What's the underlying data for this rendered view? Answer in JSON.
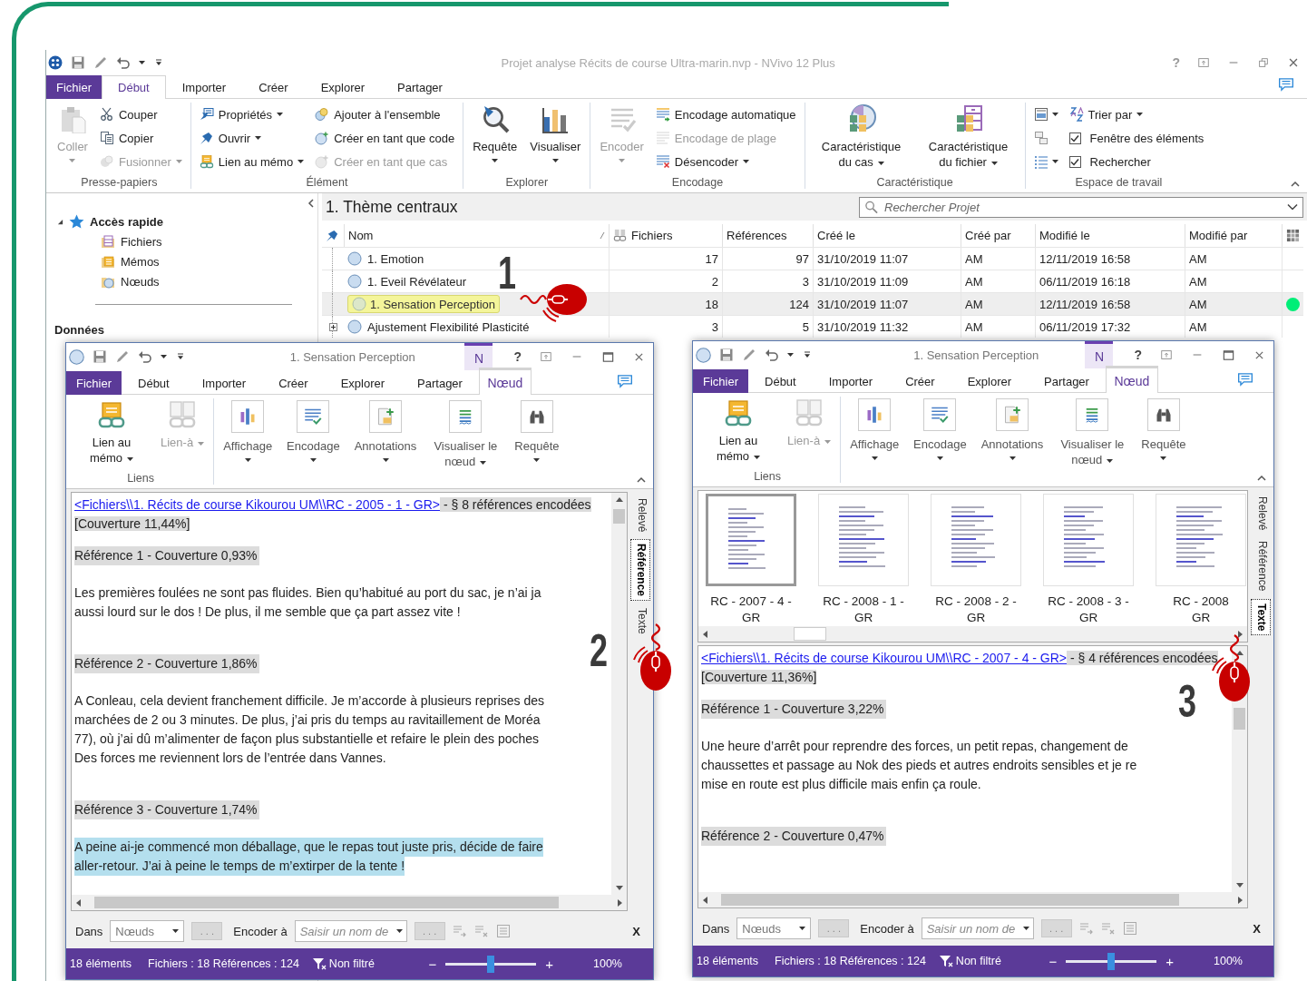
{
  "main_window": {
    "title": "Projet analyse Récits de course Ultra-marin.nvp - NVivo 12 Plus",
    "help": "?",
    "tabs": [
      {
        "label": "Fichier",
        "kind": "file",
        "selected": false
      },
      {
        "label": "Début",
        "kind": "tab",
        "selected": true
      },
      {
        "label": "Importer",
        "kind": "tab",
        "selected": false
      },
      {
        "label": "Créer",
        "kind": "tab",
        "selected": false
      },
      {
        "label": "Explorer",
        "kind": "tab",
        "selected": false
      },
      {
        "label": "Partager",
        "kind": "tab",
        "selected": false
      }
    ],
    "ribbon": [
      {
        "label": "Presse-papiers",
        "columns": [
          [
            {
              "label": "Coller",
              "kind": "large",
              "disabled": true,
              "dropdown": true
            }
          ],
          [
            {
              "label": "Couper",
              "kind": "small",
              "disabled": false,
              "dropdown": false
            },
            {
              "label": "Copier",
              "kind": "small",
              "disabled": false,
              "dropdown": false
            },
            {
              "label": "Fusionner",
              "kind": "small",
              "disabled": true,
              "dropdown": true
            }
          ]
        ]
      },
      {
        "label": "Élément",
        "columns": [
          [
            {
              "label": "Propriétés",
              "kind": "small",
              "disabled": false,
              "dropdown": true
            },
            {
              "label": "Ouvrir",
              "kind": "small",
              "disabled": false,
              "dropdown": true
            },
            {
              "label": "Lien au mémo",
              "kind": "small",
              "disabled": false,
              "dropdown": true
            }
          ],
          [
            {
              "label": "Ajouter à l'ensemble",
              "kind": "small",
              "disabled": false,
              "dropdown": false
            },
            {
              "label": "Créer en tant que code",
              "kind": "small",
              "disabled": false,
              "dropdown": false
            },
            {
              "label": "Créer en tant que cas",
              "kind": "small",
              "disabled": true,
              "dropdown": false
            }
          ]
        ]
      },
      {
        "label": "Explorer",
        "columns": [
          [
            {
              "label": "Requête",
              "kind": "large",
              "disabled": false,
              "dropdown": true
            }
          ],
          [
            {
              "label": "Visualiser",
              "kind": "large",
              "disabled": false,
              "dropdown": true
            }
          ]
        ]
      },
      {
        "label": "Encodage",
        "columns": [
          [
            {
              "label": "Encoder",
              "kind": "large",
              "disabled": true,
              "dropdown": true
            }
          ],
          [
            {
              "label": "Encodage automatique",
              "kind": "small",
              "disabled": false,
              "dropdown": false
            },
            {
              "label": "Encodage de plage",
              "kind": "small",
              "disabled": true,
              "dropdown": false
            },
            {
              "label": "Désencoder",
              "kind": "small",
              "disabled": false,
              "dropdown": true
            }
          ]
        ]
      },
      {
        "label": "Caractéristique",
        "columns": [
          [
            {
              "label": "Caractéristique du cas",
              "kind": "large",
              "disabled": false,
              "dropdown": true
            }
          ],
          [
            {
              "label": "Caractéristique du fichier",
              "kind": "large",
              "disabled": false,
              "dropdown": true
            }
          ]
        ]
      },
      {
        "label": "Espace de travail",
        "columns": [
          [
            {
              "kind": "icon",
              "disabled": false,
              "dropdown": true
            },
            {
              "kind": "icon",
              "disabled": false,
              "dropdown": false
            },
            {
              "kind": "icon",
              "disabled": false,
              "dropdown": true
            }
          ],
          [
            {
              "label": "Trier par",
              "kind": "small",
              "disabled": false,
              "dropdown": true
            },
            {
              "label": "Fenêtre des éléments",
              "kind": "check",
              "checked": true
            },
            {
              "label": "Rechercher",
              "kind": "check",
              "checked": true
            }
          ]
        ]
      }
    ],
    "navigation": {
      "quick_access": {
        "label": "Accès rapide",
        "expanded": true,
        "children": [
          {
            "label": "Fichiers"
          },
          {
            "label": "Mémos"
          },
          {
            "label": "Nœuds"
          }
        ]
      },
      "sections": [
        {
          "label": "Données"
        }
      ]
    },
    "content": {
      "title": "1. Thème centraux",
      "search": {
        "placeholder": "Rechercher Projet"
      },
      "columns": [
        {
          "label": "Nom"
        },
        {
          "label": "Fichiers"
        },
        {
          "label": "Références"
        },
        {
          "label": "Créé le"
        },
        {
          "label": "Créé par"
        },
        {
          "label": "Modifié le"
        },
        {
          "label": "Modifié par"
        }
      ],
      "rows": [
        {
          "name": "1. Emotion",
          "files": "17",
          "references": "97",
          "created": "31/10/2019 11:07",
          "created_by": "AM",
          "modified": "12/11/2019 16:58",
          "modified_by": "AM",
          "selected": false
        },
        {
          "name": "1. Eveil Révélateur",
          "files": "2",
          "references": "3",
          "created": "31/10/2019 11:09",
          "created_by": "AM",
          "modified": "06/11/2019 16:18",
          "modified_by": "AM",
          "selected": false
        },
        {
          "name": "1. Sensation Perception",
          "files": "18",
          "references": "124",
          "created": "31/10/2019 11:07",
          "created_by": "AM",
          "modified": "12/11/2019 16:58",
          "modified_by": "AM",
          "selected": true,
          "color": "#00ee77"
        },
        {
          "name": "Ajustement Flexibilité Plasticité",
          "files": "3",
          "references": "5",
          "created": "31/10/2019 11:32",
          "created_by": "AM",
          "modified": "06/11/2019 17:32",
          "modified_by": "AM",
          "selected": false,
          "expanded": false
        }
      ]
    }
  },
  "child_windows": [
    {
      "title": "1. Sensation Perception",
      "context_label": "N",
      "help": "?",
      "tabs": [
        {
          "label": "Fichier",
          "kind": "file",
          "selected": false
        },
        {
          "label": "Début",
          "kind": "tab",
          "selected": false
        },
        {
          "label": "Importer",
          "kind": "tab",
          "selected": false
        },
        {
          "label": "Créer",
          "kind": "tab",
          "selected": false
        },
        {
          "label": "Explorer",
          "kind": "tab",
          "selected": false
        },
        {
          "label": "Partager",
          "kind": "tab",
          "selected": false
        },
        {
          "label": "Nœud",
          "kind": "context",
          "selected": true
        }
      ],
      "ribbon": [
        {
          "label": "Liens",
          "columns": [
            [
              {
                "label": "Lien au mémo",
                "kind": "large",
                "disabled": false,
                "dropdown": true
              }
            ],
            [
              {
                "label": "Lien-à",
                "kind": "large",
                "disabled": true,
                "dropdown": true
              }
            ]
          ]
        },
        {
          "columns": [
            [
              {
                "label": "Affichage",
                "kind": "framed",
                "disabled": false,
                "dropdown": true
              }
            ],
            [
              {
                "label": "Encodage",
                "kind": "framed",
                "disabled": false,
                "dropdown": true
              }
            ],
            [
              {
                "label": "Annotations",
                "kind": "framed",
                "disabled": false,
                "dropdown": true
              }
            ],
            [
              {
                "label": "Visualiser le nœud",
                "kind": "framed",
                "disabled": false,
                "dropdown": true
              }
            ],
            [
              {
                "label": "Requête",
                "kind": "framed",
                "disabled": false,
                "dropdown": true
              }
            ]
          ]
        }
      ],
      "document": {
        "link": "<Fichiers\\\\1. Récits de course Kikourou UM\\\\RC - 2005 - 1 - GR>",
        "summary": "- § 8 références encodées",
        "coverage": "[Couverture 11,44%]",
        "blocks": [
          {
            "kind": "reference",
            "text": "Référence 1 - Couverture 0,93%"
          },
          {
            "kind": "passage",
            "highlighted": false,
            "lines": [
              "Les premières foulées ne sont pas fluides. Bien qu’habitué au port du sac, je n’ai ja",
              "aussi lourd sur le dos ! De plus, il me semble que ça part assez vite !"
            ]
          },
          {
            "kind": "reference",
            "text": "Référence 2 - Couverture 1,86%"
          },
          {
            "kind": "passage",
            "highlighted": false,
            "lines": [
              "A Conleau, cela devient franchement difficile. Je m’accorde à plusieurs reprises des",
              "marchées de 2 ou 3 minutes. De plus, j’ai pris du temps au ravitaillement de Moréa",
              "77), où j’ai dû m’alimenter de façon plus substantielle et refaire le plein des poches",
              "Des forces me reviennent lors de l’entrée dans Vannes."
            ]
          },
          {
            "kind": "reference",
            "text": "Référence 3 - Couverture 1,74%"
          },
          {
            "kind": "passage",
            "highlighted": true,
            "lines": [
              "A peine ai-je commencé mon déballage, que le repas tout juste pris, décide de faire",
              "aller-retour. J’ai à peine le temps de m’extirper de la tente !"
            ]
          }
        ]
      },
      "side_tabs": [
        {
          "label": "Relevé",
          "selected": false
        },
        {
          "label": "Référence",
          "selected": true
        },
        {
          "label": "Texte",
          "selected": false
        }
      ],
      "coding_bar": {
        "in_label": "Dans",
        "in_value": "Nœuds",
        "browse": ". . .",
        "code_label": "Encoder à",
        "code_placeholder": "Saisir un nom de",
        "browse_code": ". . .",
        "close": "X"
      },
      "status": {
        "items": "18 éléments",
        "counts": "Fichiers : 18  Références : 124",
        "filter": "Non filtré",
        "zoom_out": "−",
        "zoom_in": "+",
        "zoom_slider": {
          "level": 0.5
        },
        "zoom": "100%"
      }
    },
    {
      "title": "1. Sensation Perception",
      "context_label": "N",
      "help": "?",
      "tabs": [
        {
          "label": "Fichier",
          "kind": "file",
          "selected": false
        },
        {
          "label": "Début",
          "kind": "tab",
          "selected": false
        },
        {
          "label": "Importer",
          "kind": "tab",
          "selected": false
        },
        {
          "label": "Créer",
          "kind": "tab",
          "selected": false
        },
        {
          "label": "Explorer",
          "kind": "tab",
          "selected": false
        },
        {
          "label": "Partager",
          "kind": "tab",
          "selected": false
        },
        {
          "label": "Nœud",
          "kind": "context",
          "selected": true
        }
      ],
      "ribbon": [
        {
          "label": "Liens",
          "columns": [
            [
              {
                "label": "Lien au mémo",
                "kind": "large",
                "disabled": false,
                "dropdown": true
              }
            ],
            [
              {
                "label": "Lien-à",
                "kind": "large",
                "disabled": true,
                "dropdown": true
              }
            ]
          ]
        },
        {
          "columns": [
            [
              {
                "label": "Affichage",
                "kind": "framed",
                "disabled": false,
                "dropdown": true
              }
            ],
            [
              {
                "label": "Encodage",
                "kind": "framed",
                "disabled": false,
                "dropdown": true
              }
            ],
            [
              {
                "label": "Annotations",
                "kind": "framed",
                "disabled": false,
                "dropdown": true
              }
            ],
            [
              {
                "label": "Visualiser le nœud",
                "kind": "framed",
                "disabled": false,
                "dropdown": true
              }
            ],
            [
              {
                "label": "Requête",
                "kind": "framed",
                "disabled": false,
                "dropdown": true
              }
            ]
          ]
        }
      ],
      "thumbnails": [
        {
          "lines": [
            "RC - 2007 - 4 -",
            "GR"
          ],
          "selected": true
        },
        {
          "lines": [
            "RC - 2008 - 1 -",
            "GR"
          ],
          "selected": false
        },
        {
          "lines": [
            "RC - 2008 - 2 -",
            "GR"
          ],
          "selected": false
        },
        {
          "lines": [
            "RC - 2008 - 3 -",
            "GR"
          ],
          "selected": false
        },
        {
          "lines": [
            "RC - 2008",
            "GR"
          ],
          "selected": false
        }
      ],
      "document": {
        "link": "<Fichiers\\\\1. Récits de course Kikourou UM\\\\RC - 2007 - 4 - GR>",
        "summary": "- § 4 références encodées",
        "coverage": "[Couverture 11,36%]",
        "blocks": [
          {
            "kind": "reference",
            "text": "Référence 1 - Couverture 3,22%"
          },
          {
            "kind": "passage",
            "highlighted": false,
            "lines": [
              "Une heure d’arrêt pour reprendre des forces, un petit repas, changement de",
              "chaussettes et passage au Nok des pieds et autres endroits sensibles et je re",
              "mise en route est plus difficile mais enfin ça roule."
            ]
          },
          {
            "kind": "reference",
            "text": "Référence 2 - Couverture 0,47%"
          }
        ]
      },
      "side_tabs": [
        {
          "label": "Relevé",
          "selected": false
        },
        {
          "label": "Référence",
          "selected": false
        },
        {
          "label": "Texte",
          "selected": true
        }
      ],
      "coding_bar": {
        "in_label": "Dans",
        "in_value": "Nœuds",
        "browse": ". . .",
        "code_label": "Encoder à",
        "code_placeholder": "Saisir un nom de",
        "browse_code": ". . .",
        "close": "X"
      },
      "status": {
        "items": "18 éléments",
        "counts": "Fichiers : 18  Références : 124",
        "filter": "Non filtré",
        "zoom_out": "−",
        "zoom_in": "+",
        "zoom_slider": {
          "level": 0.5
        },
        "zoom": "100%"
      }
    }
  ],
  "annotations": [
    {
      "label": "1"
    },
    {
      "label": "2"
    },
    {
      "label": "3"
    }
  ]
}
